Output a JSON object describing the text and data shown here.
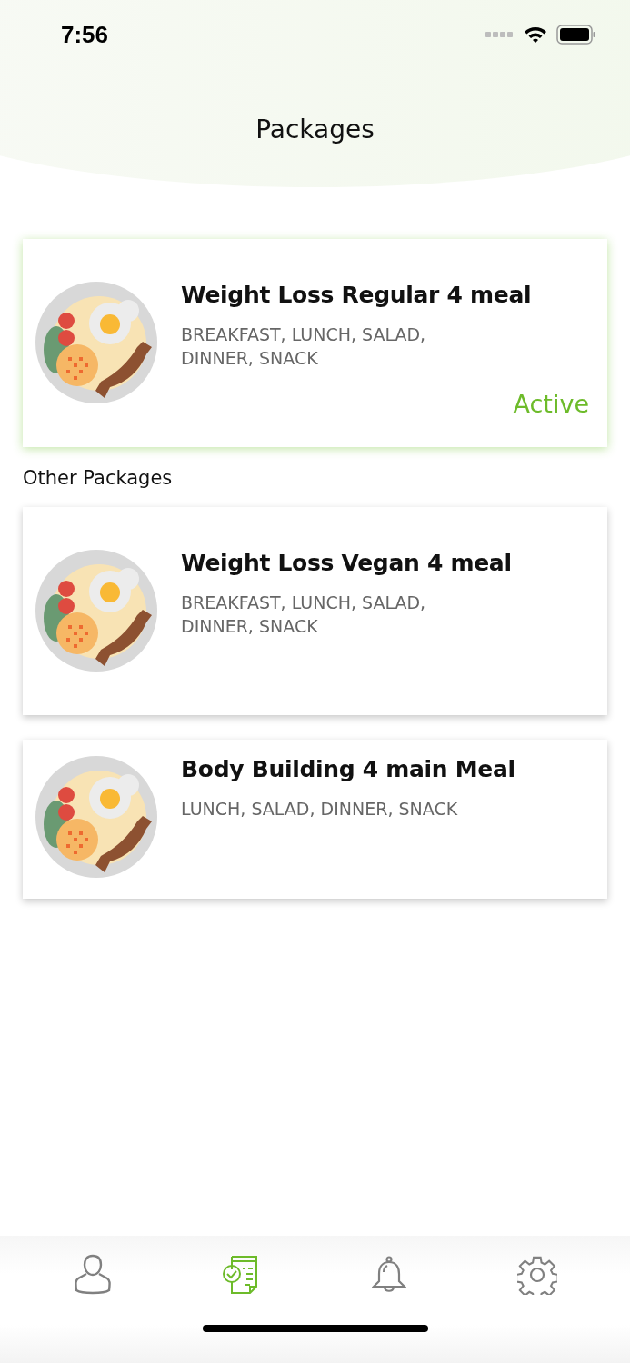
{
  "status_bar": {
    "time": "7:56"
  },
  "header": {
    "title": "Packages"
  },
  "active_package": {
    "title": "Weight Loss Regular 4 meal",
    "meals": "BREAKFAST, LUNCH, SALAD, DINNER, SNACK",
    "status": "Active"
  },
  "other_packages_label": "Other Packages",
  "other_packages": [
    {
      "title": "Weight Loss Vegan 4 meal",
      "meals": "BREAKFAST, LUNCH, SALAD, DINNER, SNACK"
    },
    {
      "title": "Body Building 4 main Meal",
      "meals": "LUNCH, SALAD, DINNER, SNACK"
    }
  ],
  "tab_bar": [
    {
      "kind": "profile",
      "selected": false
    },
    {
      "kind": "packages",
      "selected": true
    },
    {
      "kind": "notifications",
      "selected": false
    },
    {
      "kind": "settings",
      "selected": false
    }
  ]
}
